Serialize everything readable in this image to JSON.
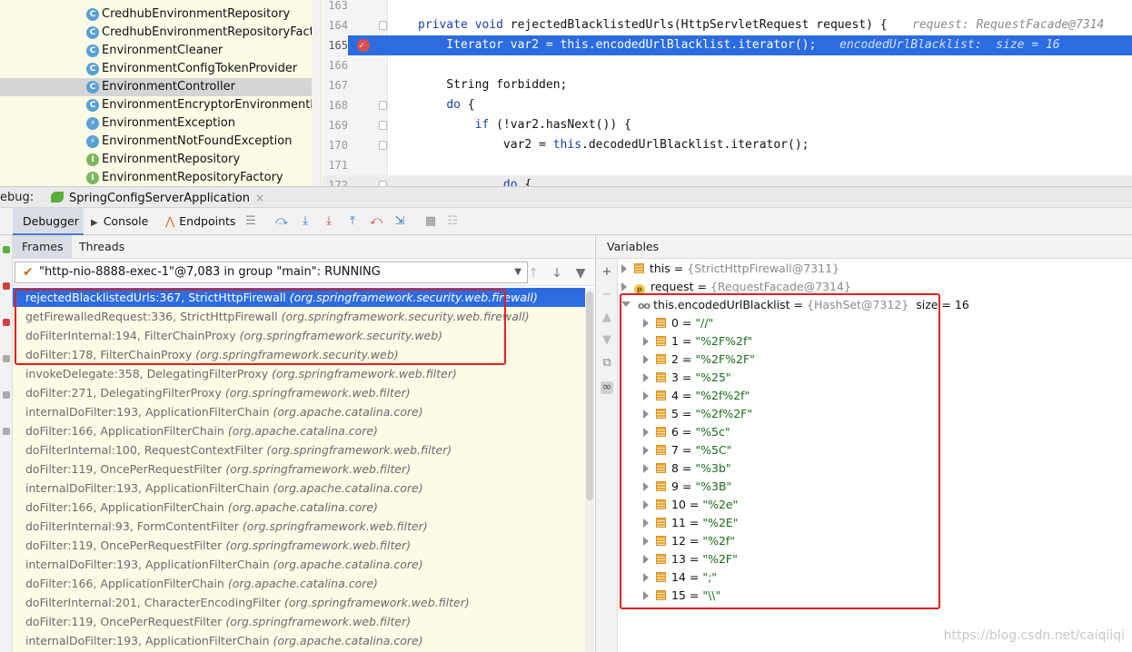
{
  "project_tree": {
    "items": [
      {
        "label": "CredhubEnvironmentRepository",
        "icon": "class-icon"
      },
      {
        "label": "CredhubEnvironmentRepositoryFactory",
        "icon": "class-icon"
      },
      {
        "label": "EnvironmentCleaner",
        "icon": "class-icon"
      },
      {
        "label": "EnvironmentConfigTokenProvider",
        "icon": "class-icon"
      },
      {
        "label": "EnvironmentController",
        "icon": "class-icon",
        "selected": true
      },
      {
        "label": "EnvironmentEncryptorEnvironmentReposi",
        "icon": "class-icon"
      },
      {
        "label": "EnvironmentException",
        "icon": "exception-class-icon"
      },
      {
        "label": "EnvironmentNotFoundException",
        "icon": "exception-class-icon"
      },
      {
        "label": "EnvironmentRepository",
        "icon": "interface-icon"
      },
      {
        "label": "EnvironmentRepositoryFactory",
        "icon": "interface-icon"
      }
    ]
  },
  "editor": {
    "lines": [
      {
        "num": "163",
        "code": "",
        "hint": ""
      },
      {
        "num": "164",
        "code": "private void rejectedBlacklistedUrls(HttpServletRequest request) {",
        "hint": "request: RequestFacade@7314"
      },
      {
        "num": "165",
        "code": "    Iterator var2 = this.encodedUrlBlacklist.iterator();",
        "hint": "encodedUrlBlacklist:  size = 16"
      },
      {
        "num": "166",
        "code": "",
        "hint": ""
      },
      {
        "num": "167",
        "code": "    String forbidden;",
        "hint": ""
      },
      {
        "num": "168",
        "code": "    do {",
        "hint": ""
      },
      {
        "num": "169",
        "code": "        if (!var2.hasNext()) {",
        "hint": ""
      },
      {
        "num": "170",
        "code": "            var2 = this.decodedUrlBlacklist.iterator();",
        "hint": ""
      },
      {
        "num": "171",
        "code": "",
        "hint": ""
      },
      {
        "num": "172",
        "code": "            do {",
        "hint": ""
      }
    ]
  },
  "debug_window": {
    "label": "ebug:",
    "session_tab": "SpringConfigServerApplication",
    "session_close": "×"
  },
  "toolbar": {
    "debugger_tab": "Debugger",
    "console_tab": "Console",
    "endpoints_tab": "Endpoints"
  },
  "frames_panel": {
    "frames_tab": "Frames",
    "threads_tab": "Threads",
    "thread_selector": "\"http-nio-8888-exec-1\"@7,083 in group \"main\": RUNNING",
    "frames": [
      {
        "method": "rejectedBlacklistedUrls:367, StrictHttpFirewall",
        "pkg": "(org.springframework.security.web.firewall)"
      },
      {
        "method": "getFirewalledRequest:336, StrictHttpFirewall",
        "pkg": "(org.springframework.security.web.firewall)"
      },
      {
        "method": "doFilterInternal:194, FilterChainProxy",
        "pkg": "(org.springframework.security.web)"
      },
      {
        "method": "doFilter:178, FilterChainProxy",
        "pkg": "(org.springframework.security.web)"
      },
      {
        "method": "invokeDelegate:358, DelegatingFilterProxy",
        "pkg": "(org.springframework.web.filter)"
      },
      {
        "method": "doFilter:271, DelegatingFilterProxy",
        "pkg": "(org.springframework.web.filter)"
      },
      {
        "method": "internalDoFilter:193, ApplicationFilterChain",
        "pkg": "(org.apache.catalina.core)"
      },
      {
        "method": "doFilter:166, ApplicationFilterChain",
        "pkg": "(org.apache.catalina.core)"
      },
      {
        "method": "doFilterInternal:100, RequestContextFilter",
        "pkg": "(org.springframework.web.filter)"
      },
      {
        "method": "doFilter:119, OncePerRequestFilter",
        "pkg": "(org.springframework.web.filter)"
      },
      {
        "method": "internalDoFilter:193, ApplicationFilterChain",
        "pkg": "(org.apache.catalina.core)"
      },
      {
        "method": "doFilter:166, ApplicationFilterChain",
        "pkg": "(org.apache.catalina.core)"
      },
      {
        "method": "doFilterInternal:93, FormContentFilter",
        "pkg": "(org.springframework.web.filter)"
      },
      {
        "method": "doFilter:119, OncePerRequestFilter",
        "pkg": "(org.springframework.web.filter)"
      },
      {
        "method": "internalDoFilter:193, ApplicationFilterChain",
        "pkg": "(org.apache.catalina.core)"
      },
      {
        "method": "doFilter:166, ApplicationFilterChain",
        "pkg": "(org.apache.catalina.core)"
      },
      {
        "method": "doFilterInternal:201, CharacterEncodingFilter",
        "pkg": "(org.springframework.web.filter)"
      },
      {
        "method": "doFilter:119, OncePerRequestFilter",
        "pkg": "(org.springframework.web.filter)"
      },
      {
        "method": "internalDoFilter:193, ApplicationFilterChain",
        "pkg": "(org.apache.catalina.core)"
      }
    ]
  },
  "variables_panel": {
    "title": "Variables",
    "this_var": {
      "name": "this",
      "eq": "=",
      "value": "{StrictHttpFirewall@7311}"
    },
    "request_var": {
      "name": "request",
      "eq": "=",
      "value": "{RequestFacade@7314}"
    },
    "blacklist_var": {
      "name": "this.encodedUrlBlacklist",
      "eq": "=",
      "value": "{HashSet@7312}",
      "size": "size = 16"
    },
    "entries": [
      {
        "index": "0",
        "value": "\"//\""
      },
      {
        "index": "1",
        "value": "\"%2F%2f\""
      },
      {
        "index": "2",
        "value": "\"%2F%2F\""
      },
      {
        "index": "3",
        "value": "\"%25\""
      },
      {
        "index": "4",
        "value": "\"%2f%2f\""
      },
      {
        "index": "5",
        "value": "\"%2f%2F\""
      },
      {
        "index": "6",
        "value": "\"%5c\""
      },
      {
        "index": "7",
        "value": "\"%5C\""
      },
      {
        "index": "8",
        "value": "\"%3b\""
      },
      {
        "index": "9",
        "value": "\"%3B\""
      },
      {
        "index": "10",
        "value": "\"%2e\""
      },
      {
        "index": "11",
        "value": "\"%2E\""
      },
      {
        "index": "12",
        "value": "\"%2f\""
      },
      {
        "index": "13",
        "value": "\"%2F\""
      },
      {
        "index": "14",
        "value": "\";\""
      },
      {
        "index": "15",
        "value": "\"\\\\\""
      }
    ]
  },
  "watermark": "https://blog.csdn.net/caiqiiqi",
  "colors": {
    "selection_blue": "#2d6cdf",
    "annotation_red": "#e02020",
    "tree_background": "#fbfbe6",
    "keyword_blue": "#1a3fae"
  }
}
